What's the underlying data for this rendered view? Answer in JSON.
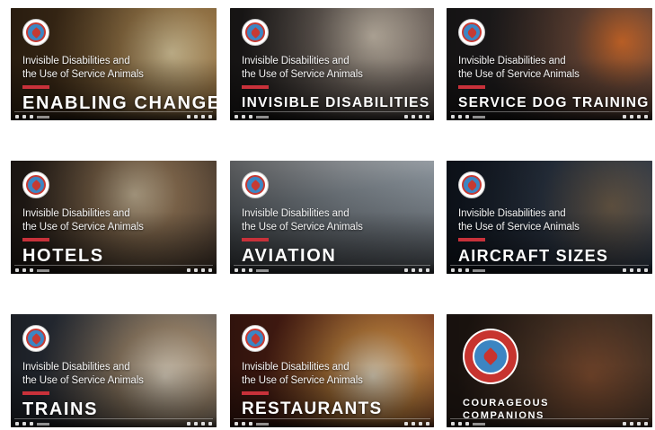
{
  "common": {
    "subtitle_line1": "Invisible Disabilities and",
    "subtitle_line2": "the Use of Service Animals",
    "logo_icon": "maple-leaf-logo-icon"
  },
  "videos": [
    {
      "title": "ENABLING CHANGE",
      "bg": "#6a5133"
    },
    {
      "title": "INVISIBLE DISABILITIES",
      "bg": "#4d4743"
    },
    {
      "title": "SERVICE DOG TRAINING",
      "bg": "#3f3a3a"
    },
    {
      "title": "HOTELS",
      "bg": "#5a4a3b"
    },
    {
      "title": "AVIATION",
      "bg": "#55606b"
    },
    {
      "title": "AIRCRAFT SIZES",
      "bg": "#2c3a4d"
    },
    {
      "title": "TRAINS",
      "bg": "#505863"
    },
    {
      "title": "RESTAURANTS",
      "bg": "#7a3a2a"
    },
    {
      "title_line1": "COURAGEOUS",
      "title_line2": "COMPANIONS",
      "badge_icon": "courageous-companions-badge-icon",
      "bg": "#3b2b22"
    }
  ],
  "colors": {
    "accent_red": "#c8313a",
    "logo_blue": "#3b86c4"
  }
}
